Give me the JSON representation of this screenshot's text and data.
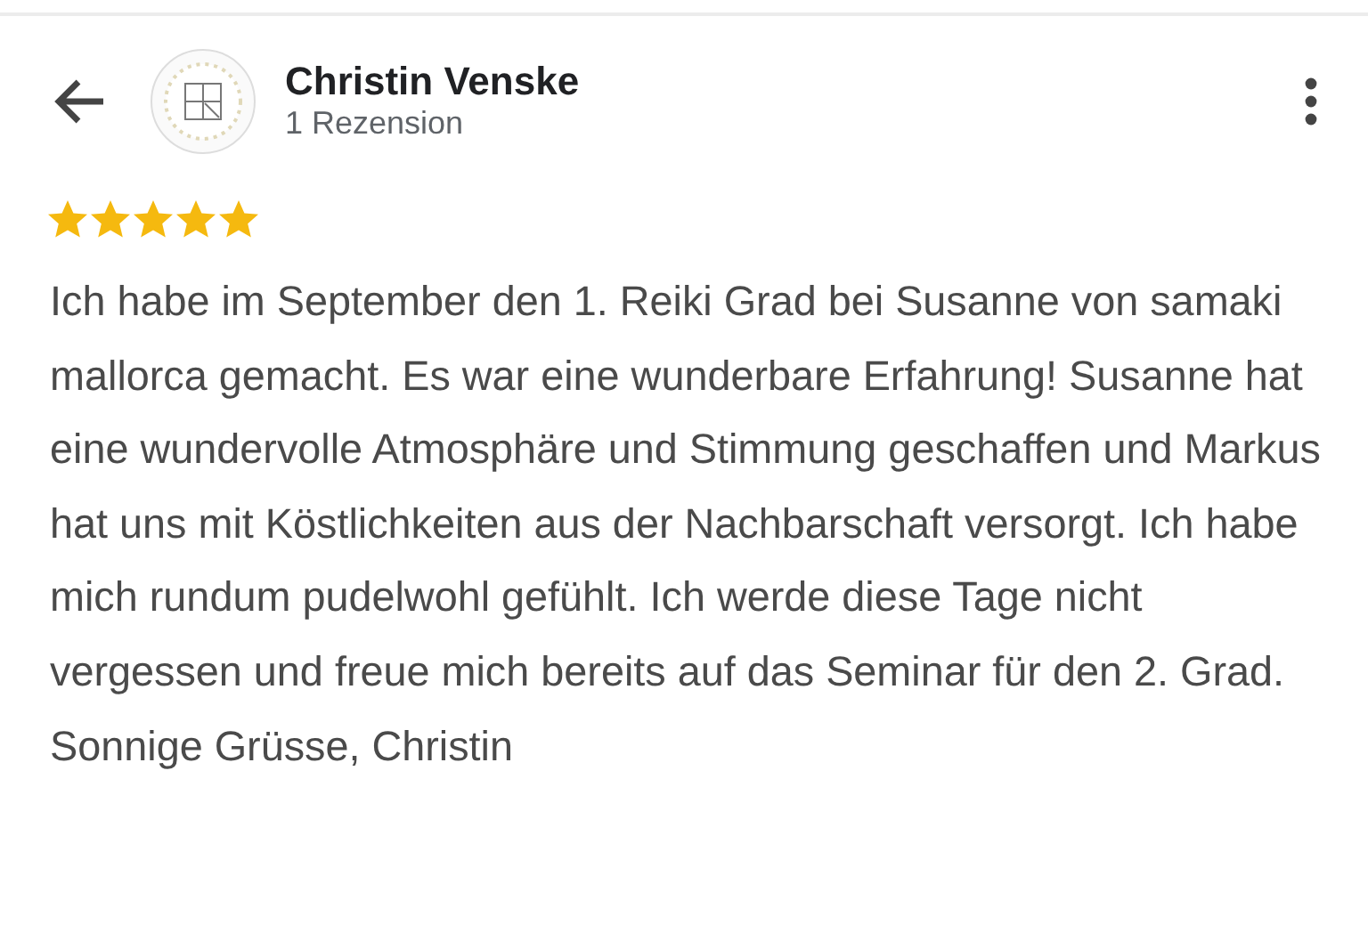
{
  "reviewer": {
    "name": "Christin Venske",
    "review_count": "1 Rezension"
  },
  "review": {
    "stars": 5,
    "text": "Ich habe im September den 1. Reiki Grad bei Susanne von samaki mallorca gemacht. Es war eine wunderbare Erfahrung! Susanne hat eine wundervolle Atmosphäre und Stimmung geschaffen und Markus hat uns mit Köstlichkeiten aus der Nachbarschaft versorgt. Ich habe mich rundum pudelwohl gefühlt. Ich werde diese Tage nicht vergessen und freue mich bereits auf das Seminar für den 2. Grad. Sonnige Grüsse, Christin"
  }
}
